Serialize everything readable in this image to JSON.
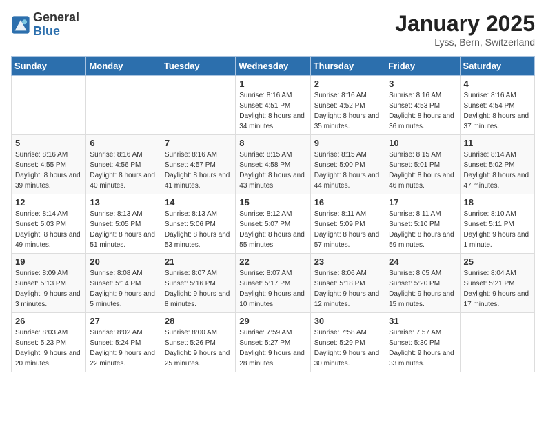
{
  "header": {
    "logo": {
      "general": "General",
      "blue": "Blue"
    },
    "title": "January 2025",
    "location": "Lyss, Bern, Switzerland"
  },
  "weekdays": [
    "Sunday",
    "Monday",
    "Tuesday",
    "Wednesday",
    "Thursday",
    "Friday",
    "Saturday"
  ],
  "weeks": [
    [
      {
        "day": "",
        "sunrise": "",
        "sunset": "",
        "daylight": ""
      },
      {
        "day": "",
        "sunrise": "",
        "sunset": "",
        "daylight": ""
      },
      {
        "day": "",
        "sunrise": "",
        "sunset": "",
        "daylight": ""
      },
      {
        "day": "1",
        "sunrise": "Sunrise: 8:16 AM",
        "sunset": "Sunset: 4:51 PM",
        "daylight": "Daylight: 8 hours and 34 minutes."
      },
      {
        "day": "2",
        "sunrise": "Sunrise: 8:16 AM",
        "sunset": "Sunset: 4:52 PM",
        "daylight": "Daylight: 8 hours and 35 minutes."
      },
      {
        "day": "3",
        "sunrise": "Sunrise: 8:16 AM",
        "sunset": "Sunset: 4:53 PM",
        "daylight": "Daylight: 8 hours and 36 minutes."
      },
      {
        "day": "4",
        "sunrise": "Sunrise: 8:16 AM",
        "sunset": "Sunset: 4:54 PM",
        "daylight": "Daylight: 8 hours and 37 minutes."
      }
    ],
    [
      {
        "day": "5",
        "sunrise": "Sunrise: 8:16 AM",
        "sunset": "Sunset: 4:55 PM",
        "daylight": "Daylight: 8 hours and 39 minutes."
      },
      {
        "day": "6",
        "sunrise": "Sunrise: 8:16 AM",
        "sunset": "Sunset: 4:56 PM",
        "daylight": "Daylight: 8 hours and 40 minutes."
      },
      {
        "day": "7",
        "sunrise": "Sunrise: 8:16 AM",
        "sunset": "Sunset: 4:57 PM",
        "daylight": "Daylight: 8 hours and 41 minutes."
      },
      {
        "day": "8",
        "sunrise": "Sunrise: 8:15 AM",
        "sunset": "Sunset: 4:58 PM",
        "daylight": "Daylight: 8 hours and 43 minutes."
      },
      {
        "day": "9",
        "sunrise": "Sunrise: 8:15 AM",
        "sunset": "Sunset: 5:00 PM",
        "daylight": "Daylight: 8 hours and 44 minutes."
      },
      {
        "day": "10",
        "sunrise": "Sunrise: 8:15 AM",
        "sunset": "Sunset: 5:01 PM",
        "daylight": "Daylight: 8 hours and 46 minutes."
      },
      {
        "day": "11",
        "sunrise": "Sunrise: 8:14 AM",
        "sunset": "Sunset: 5:02 PM",
        "daylight": "Daylight: 8 hours and 47 minutes."
      }
    ],
    [
      {
        "day": "12",
        "sunrise": "Sunrise: 8:14 AM",
        "sunset": "Sunset: 5:03 PM",
        "daylight": "Daylight: 8 hours and 49 minutes."
      },
      {
        "day": "13",
        "sunrise": "Sunrise: 8:13 AM",
        "sunset": "Sunset: 5:05 PM",
        "daylight": "Daylight: 8 hours and 51 minutes."
      },
      {
        "day": "14",
        "sunrise": "Sunrise: 8:13 AM",
        "sunset": "Sunset: 5:06 PM",
        "daylight": "Daylight: 8 hours and 53 minutes."
      },
      {
        "day": "15",
        "sunrise": "Sunrise: 8:12 AM",
        "sunset": "Sunset: 5:07 PM",
        "daylight": "Daylight: 8 hours and 55 minutes."
      },
      {
        "day": "16",
        "sunrise": "Sunrise: 8:11 AM",
        "sunset": "Sunset: 5:09 PM",
        "daylight": "Daylight: 8 hours and 57 minutes."
      },
      {
        "day": "17",
        "sunrise": "Sunrise: 8:11 AM",
        "sunset": "Sunset: 5:10 PM",
        "daylight": "Daylight: 8 hours and 59 minutes."
      },
      {
        "day": "18",
        "sunrise": "Sunrise: 8:10 AM",
        "sunset": "Sunset: 5:11 PM",
        "daylight": "Daylight: 9 hours and 1 minute."
      }
    ],
    [
      {
        "day": "19",
        "sunrise": "Sunrise: 8:09 AM",
        "sunset": "Sunset: 5:13 PM",
        "daylight": "Daylight: 9 hours and 3 minutes."
      },
      {
        "day": "20",
        "sunrise": "Sunrise: 8:08 AM",
        "sunset": "Sunset: 5:14 PM",
        "daylight": "Daylight: 9 hours and 5 minutes."
      },
      {
        "day": "21",
        "sunrise": "Sunrise: 8:07 AM",
        "sunset": "Sunset: 5:16 PM",
        "daylight": "Daylight: 9 hours and 8 minutes."
      },
      {
        "day": "22",
        "sunrise": "Sunrise: 8:07 AM",
        "sunset": "Sunset: 5:17 PM",
        "daylight": "Daylight: 9 hours and 10 minutes."
      },
      {
        "day": "23",
        "sunrise": "Sunrise: 8:06 AM",
        "sunset": "Sunset: 5:18 PM",
        "daylight": "Daylight: 9 hours and 12 minutes."
      },
      {
        "day": "24",
        "sunrise": "Sunrise: 8:05 AM",
        "sunset": "Sunset: 5:20 PM",
        "daylight": "Daylight: 9 hours and 15 minutes."
      },
      {
        "day": "25",
        "sunrise": "Sunrise: 8:04 AM",
        "sunset": "Sunset: 5:21 PM",
        "daylight": "Daylight: 9 hours and 17 minutes."
      }
    ],
    [
      {
        "day": "26",
        "sunrise": "Sunrise: 8:03 AM",
        "sunset": "Sunset: 5:23 PM",
        "daylight": "Daylight: 9 hours and 20 minutes."
      },
      {
        "day": "27",
        "sunrise": "Sunrise: 8:02 AM",
        "sunset": "Sunset: 5:24 PM",
        "daylight": "Daylight: 9 hours and 22 minutes."
      },
      {
        "day": "28",
        "sunrise": "Sunrise: 8:00 AM",
        "sunset": "Sunset: 5:26 PM",
        "daylight": "Daylight: 9 hours and 25 minutes."
      },
      {
        "day": "29",
        "sunrise": "Sunrise: 7:59 AM",
        "sunset": "Sunset: 5:27 PM",
        "daylight": "Daylight: 9 hours and 28 minutes."
      },
      {
        "day": "30",
        "sunrise": "Sunrise: 7:58 AM",
        "sunset": "Sunset: 5:29 PM",
        "daylight": "Daylight: 9 hours and 30 minutes."
      },
      {
        "day": "31",
        "sunrise": "Sunrise: 7:57 AM",
        "sunset": "Sunset: 5:30 PM",
        "daylight": "Daylight: 9 hours and 33 minutes."
      },
      {
        "day": "",
        "sunrise": "",
        "sunset": "",
        "daylight": ""
      }
    ]
  ]
}
